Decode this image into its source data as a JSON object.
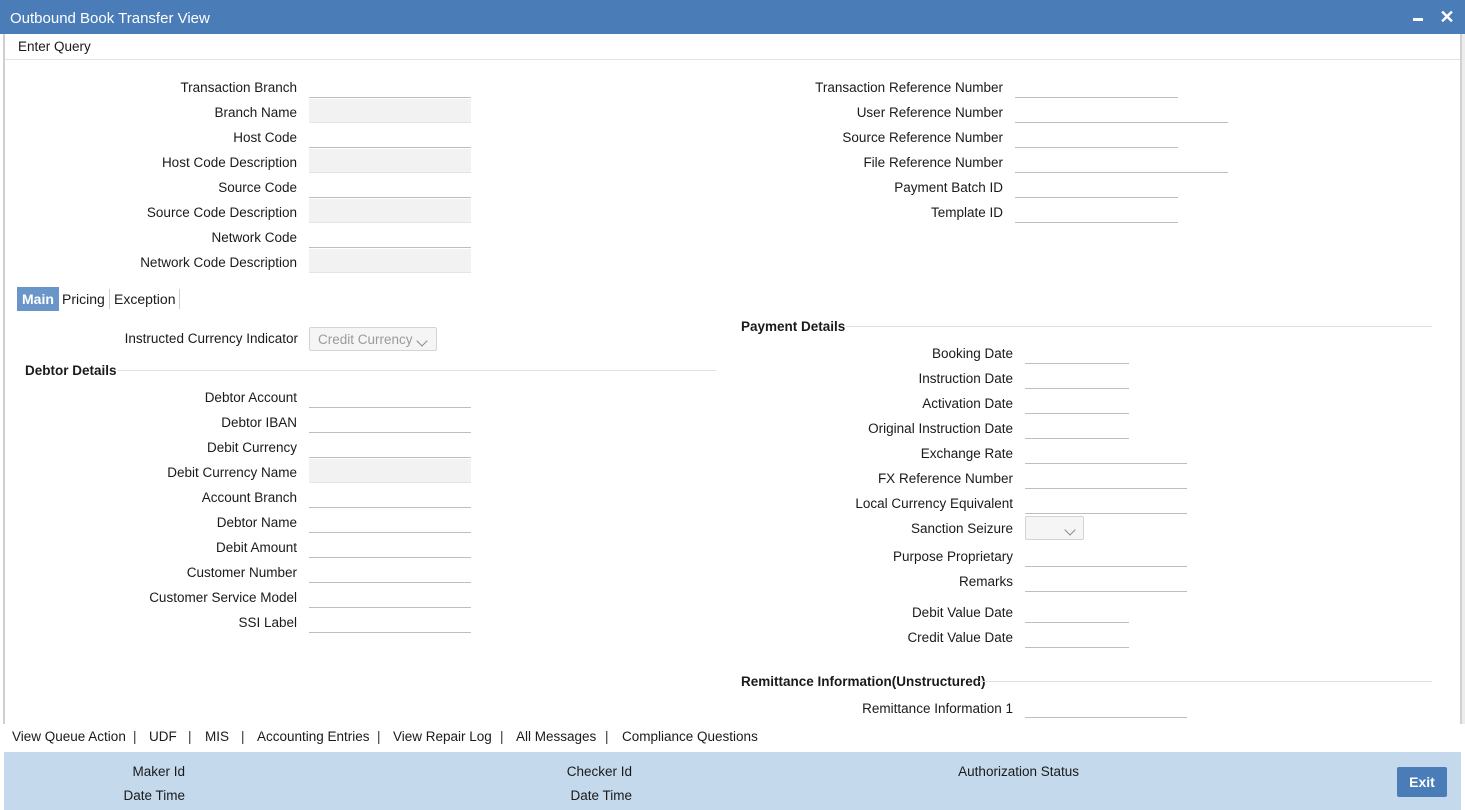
{
  "window": {
    "title": "Outbound Book Transfer View"
  },
  "menu": {
    "enter_query": "Enter Query"
  },
  "header_left": {
    "labels": [
      "Transaction Branch",
      "Branch Name",
      "Host Code",
      "Host Code Description",
      "Source Code",
      "Source Code Description",
      "Network Code",
      "Network Code Description"
    ]
  },
  "header_right": {
    "labels": [
      "Transaction Reference Number",
      "User Reference Number",
      "Source Reference Number",
      "File Reference Number",
      "Payment Batch ID",
      "Template ID"
    ]
  },
  "tabs": [
    {
      "label": "Main",
      "active": true
    },
    {
      "label": "Pricing",
      "active": false
    },
    {
      "label": "Exception",
      "active": false
    }
  ],
  "main": {
    "instructed_currency_indicator": {
      "label": "Instructed Currency Indicator",
      "value": "Credit Currency"
    },
    "debtor_details": {
      "title": "Debtor Details",
      "labels": [
        "Debtor Account",
        "Debtor IBAN",
        "Debit Currency",
        "Debit Currency Name",
        "Account Branch",
        "Debtor Name",
        "Debit Amount",
        "Customer Number",
        "Customer Service Model",
        "SSI Label"
      ]
    },
    "payment_details": {
      "title": "Payment Details",
      "labels": [
        "Booking Date",
        "Instruction Date",
        "Activation Date",
        "Original Instruction Date",
        "Exchange Rate",
        "FX Reference Number",
        "Local Currency Equivalent",
        "Sanction Seizure",
        "Purpose Proprietary",
        "Remarks",
        "Debit Value Date",
        "Credit Value Date"
      ]
    },
    "remittance": {
      "title": "Remittance Information(Unstructured)",
      "labels": [
        "Remittance Information 1"
      ]
    }
  },
  "links": [
    "View Queue Action",
    "UDF",
    "MIS",
    "Accounting Entries",
    "View Repair Log",
    "All Messages",
    "Compliance Questions"
  ],
  "footer": {
    "maker_id": "Maker Id",
    "date_time_1": "Date Time",
    "checker_id": "Checker Id",
    "date_time_2": "Date Time",
    "authorization_status": "Authorization Status",
    "exit_label": "Exit"
  },
  "colors": {
    "titlebar": "#4a7db8",
    "tab_active": "#6a95c9",
    "footer": "#c4d9ec"
  }
}
